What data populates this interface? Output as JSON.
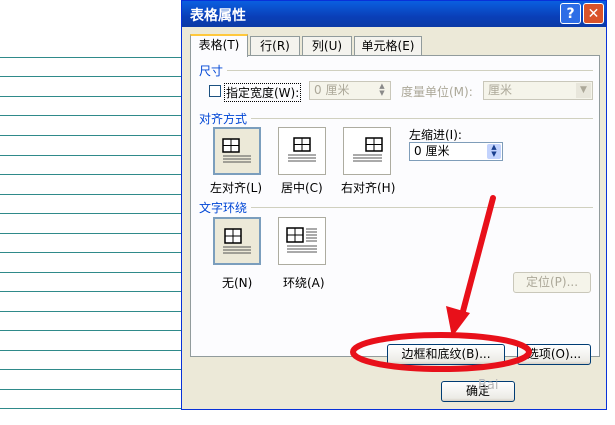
{
  "window": {
    "title": "表格属性",
    "help_glyph": "?",
    "close_glyph": "✕"
  },
  "tabs": [
    {
      "label": "表格(T)",
      "active": true
    },
    {
      "label": "行(R)"
    },
    {
      "label": "列(U)"
    },
    {
      "label": "单元格(E)"
    }
  ],
  "size_group": {
    "label": "尺寸",
    "preferred_width_label": "指定宽度(W):",
    "preferred_width_checked": false,
    "width_value": "0 厘米",
    "measure_label": "度量单位(M):",
    "measure_value": "厘米"
  },
  "alignment_group": {
    "label": "对齐方式",
    "options": [
      {
        "label": "左对齐(L)",
        "icon": "align-left-icon",
        "selected": true
      },
      {
        "label": "居中(C)",
        "icon": "align-center-icon"
      },
      {
        "label": "右对齐(H)",
        "icon": "align-right-icon"
      }
    ],
    "indent_label": "左缩进(I):",
    "indent_value": "0 厘米"
  },
  "wrap_group": {
    "label": "文字环绕",
    "options": [
      {
        "label": "无(N)",
        "icon": "wrap-none-icon",
        "selected": true
      },
      {
        "label": "环绕(A)",
        "icon": "wrap-around-icon"
      }
    ],
    "position_button": "定位(P)..."
  },
  "buttons": {
    "borders": "边框和底纹(B)...",
    "options": "选项(O)...",
    "ok": "确定"
  },
  "watermark": "Bai",
  "colors": {
    "annotation": "#e8101a",
    "title_bar": "#0a3fb8",
    "doc_lines": "#2f8a8a"
  }
}
